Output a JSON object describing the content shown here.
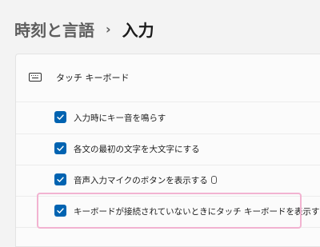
{
  "breadcrumb": {
    "parent": "時刻と言語",
    "separator": "›",
    "current": "入力"
  },
  "section": {
    "icon": "keyboard-icon",
    "title": "タッチ キーボード"
  },
  "options": [
    {
      "label": "入力時にキー音を鳴らす",
      "checked": true
    },
    {
      "label": "各文の最初の文字を大文字にする",
      "checked": true
    },
    {
      "label": "音声入力マイクのボタンを表示する",
      "checked": true,
      "trailing_icon": "microphone-icon"
    },
    {
      "label": "キーボードが接続されていないときにタッチ キーボードを表示する",
      "checked": true
    }
  ],
  "colors": {
    "accent": "#0063b1",
    "highlight": "#f2b3d1"
  }
}
